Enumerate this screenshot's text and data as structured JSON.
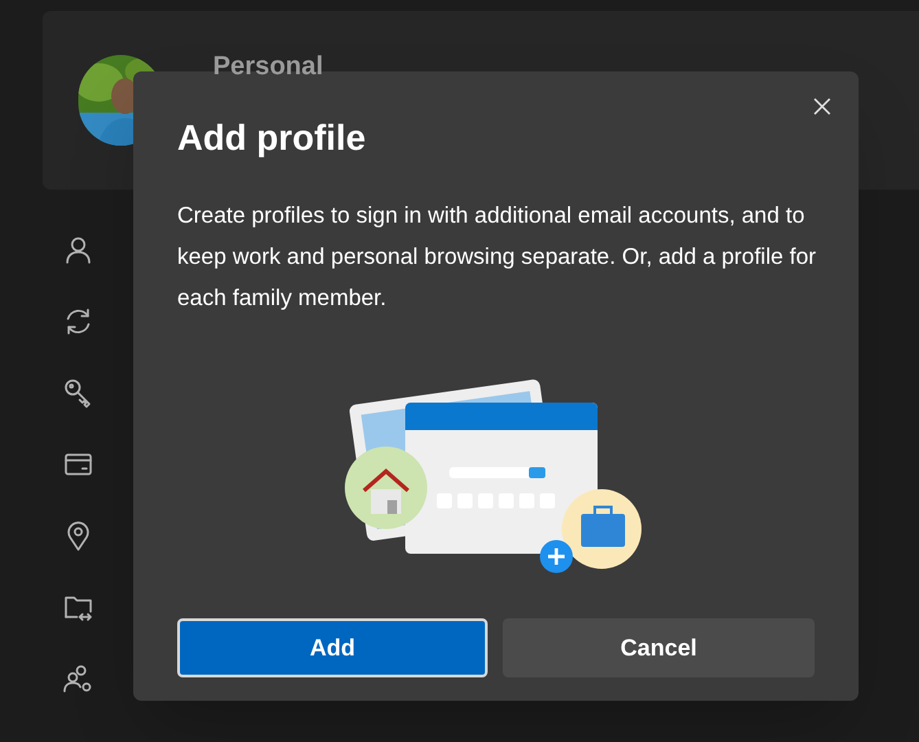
{
  "profile_card": {
    "name": "Personal"
  },
  "dialog": {
    "title": "Add profile",
    "body": "Create profiles to sign in with additional email accounts, and to keep work and personal browsing separate. Or, add a profile for each family member.",
    "buttons": [
      {
        "label": "Add",
        "kind": "primary"
      },
      {
        "label": "Cancel",
        "kind": "secondary"
      }
    ]
  }
}
